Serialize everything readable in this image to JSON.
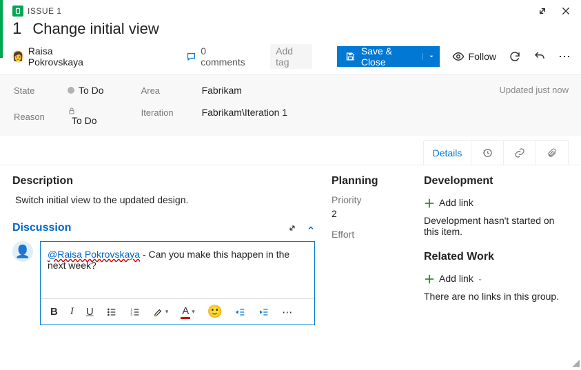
{
  "header": {
    "type_label": "ISSUE 1",
    "work_item_number": "1",
    "title": "Change initial view"
  },
  "toolbar": {
    "assignee": "Raisa Pokrovskaya",
    "comments_text": "0 comments",
    "add_tag": "Add tag",
    "save_close": "Save & Close",
    "follow": "Follow"
  },
  "meta": {
    "state_label": "State",
    "state_value": "To Do",
    "reason_label": "Reason",
    "reason_value": "To Do",
    "area_label": "Area",
    "area_value": "Fabrikam",
    "iteration_label": "Iteration",
    "iteration_value": "Fabrikam\\Iteration 1",
    "updated": "Updated just now"
  },
  "tabs": {
    "details": "Details"
  },
  "description": {
    "heading": "Description",
    "body": "Switch initial view to the updated design."
  },
  "planning": {
    "heading": "Planning",
    "priority_label": "Priority",
    "priority_value": "2",
    "effort_label": "Effort"
  },
  "development": {
    "heading": "Development",
    "add_link": "Add link",
    "empty": "Development hasn't started on this item."
  },
  "related": {
    "heading": "Related Work",
    "add_link": "Add link",
    "empty": "There are no links in this group."
  },
  "discussion": {
    "heading": "Discussion",
    "mention": "@Raisa Pokrovskaya",
    "draft_rest": " - Can you make this happen in the next week?"
  }
}
